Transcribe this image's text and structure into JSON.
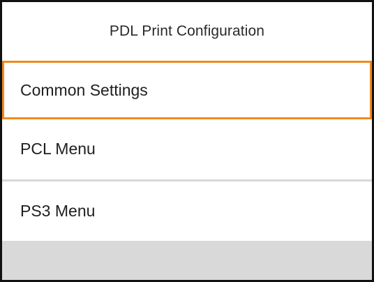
{
  "header": {
    "title": "PDL Print Configuration"
  },
  "menu": {
    "items": [
      {
        "label": "Common Settings",
        "selected": true
      },
      {
        "label": "PCL Menu",
        "selected": false
      },
      {
        "label": "PS3 Menu",
        "selected": false
      }
    ]
  },
  "colors": {
    "selection_border": "#f08a1c",
    "footer_bar": "#d9d9d9",
    "frame": "#111111"
  }
}
